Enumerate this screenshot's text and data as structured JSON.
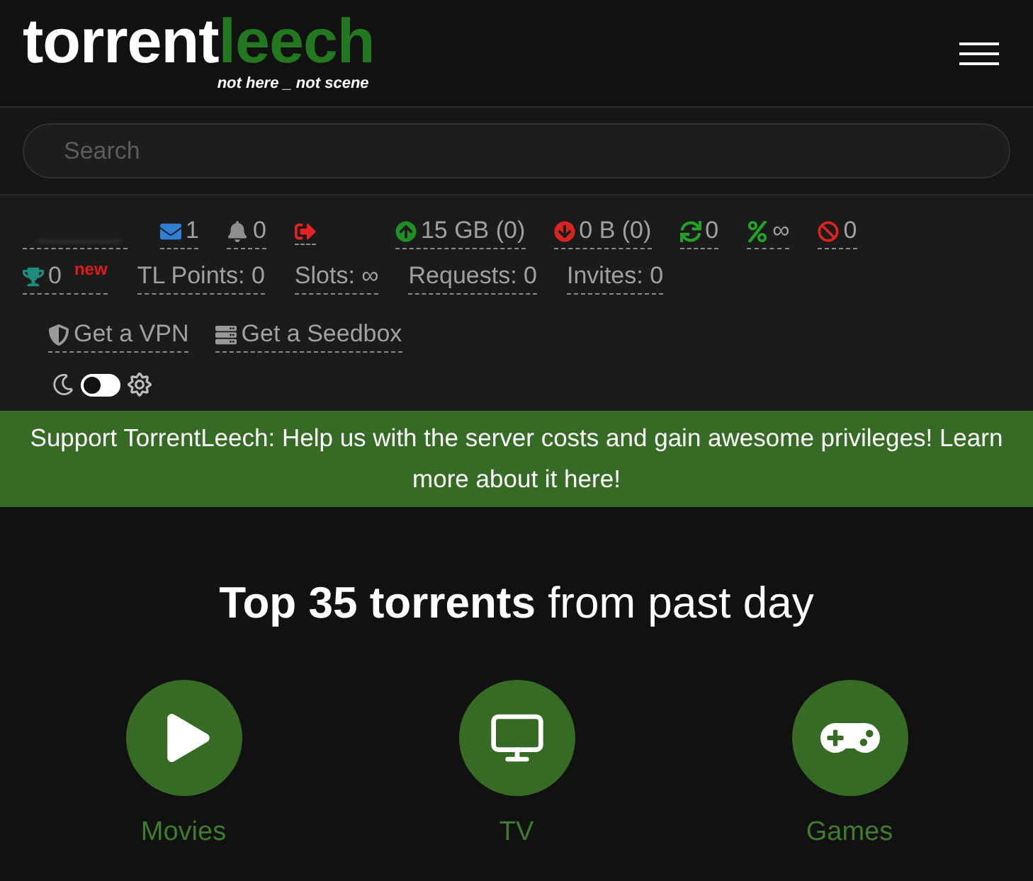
{
  "header": {
    "logo": {
      "part_1": "torrent",
      "part_2": "leech",
      "tagline": "not here _ not scene"
    }
  },
  "search": {
    "placeholder": "Search"
  },
  "stats": {
    "row_1": [
      {
        "kind": "envelope",
        "text": "1"
      },
      {
        "kind": "bell",
        "text": "0"
      },
      {
        "kind": "exit"
      },
      {
        "kind": "upload",
        "text": "15 GB (0)"
      },
      {
        "kind": "download",
        "text": "0 B (0)"
      },
      {
        "kind": "sync",
        "text": "0"
      },
      {
        "kind": "percent",
        "text": "∞"
      },
      {
        "kind": "ban",
        "text": "0"
      }
    ],
    "row_2": [
      {
        "kind": "trophy",
        "text": "0",
        "badge": "new"
      },
      {
        "kind": "plain",
        "text": "TL Points: 0"
      },
      {
        "kind": "plain",
        "text": "Slots: ∞"
      },
      {
        "kind": "plain",
        "text": "Requests: 0"
      },
      {
        "kind": "plain",
        "text": "Invites: 0"
      }
    ],
    "row_3": [
      {
        "kind": "shield",
        "text": "Get a VPN"
      },
      {
        "kind": "server",
        "text": "Get a Seedbox"
      }
    ],
    "theme_switch": {
      "on": false
    }
  },
  "banner": {
    "text": "Support TorrentLeech: Help us with the server costs and gain awesome privileges! Learn more about it here!"
  },
  "top": {
    "heading": "**Top 35 torrents** from past day",
    "categories": [
      {
        "kind": "play",
        "label": "Movies"
      },
      {
        "kind": "tv",
        "label": "TV"
      },
      {
        "kind": "gamepad",
        "label": "Games"
      }
    ]
  }
}
